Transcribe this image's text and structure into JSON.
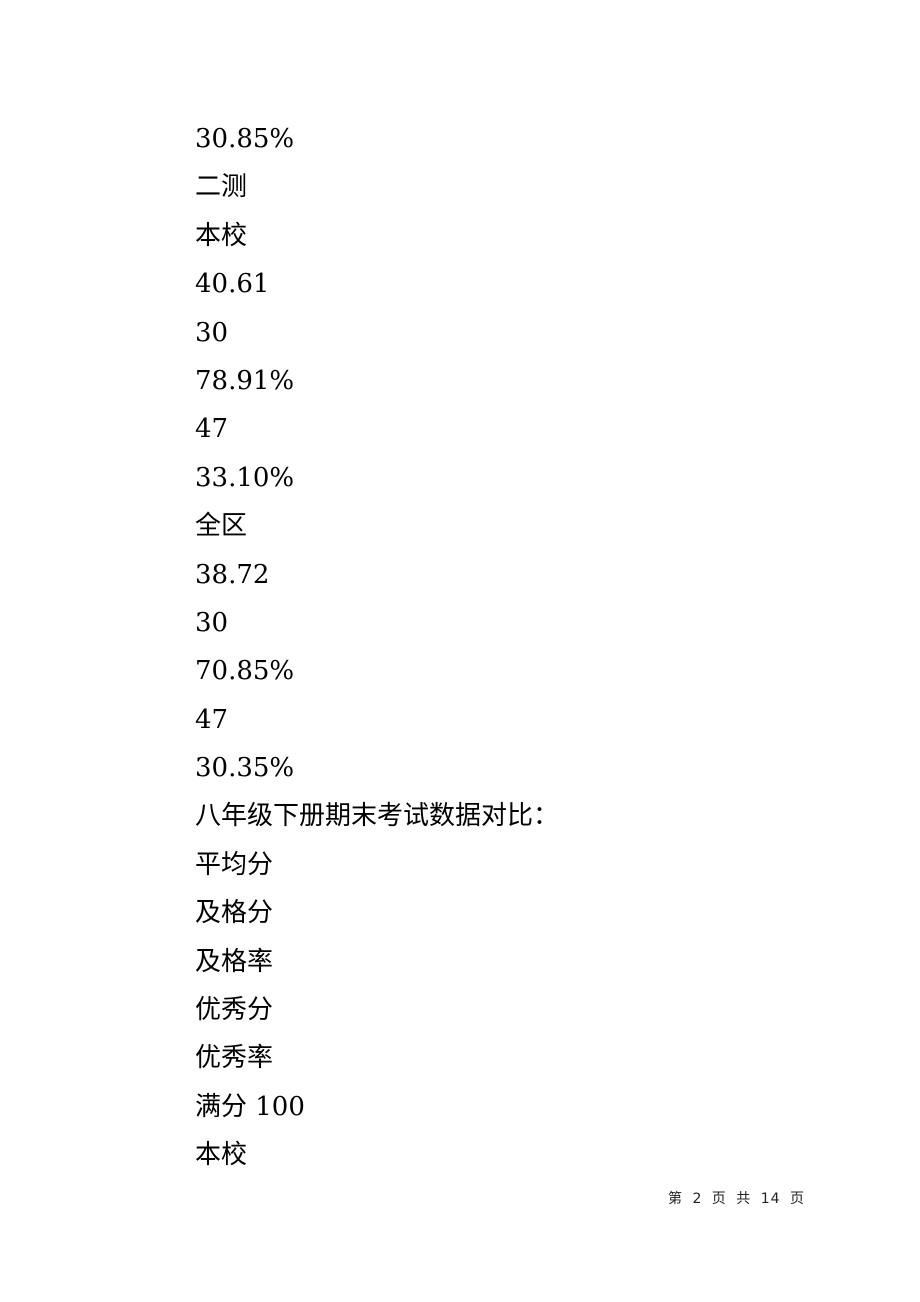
{
  "document": {
    "lines": [
      "30.85%",
      "二测",
      "本校",
      "40.61",
      "30",
      "78.91%",
      "47",
      "33.10%",
      "全区",
      "38.72",
      "30",
      "70.85%",
      "47",
      "30.35%",
      "八年级下册期末考试数据对比：",
      "平均分",
      "及格分",
      "及格率",
      "优秀分",
      "优秀率",
      "满分 100",
      "本校"
    ]
  },
  "footer": {
    "page_indicator": "第 2 页 共 14 页"
  }
}
